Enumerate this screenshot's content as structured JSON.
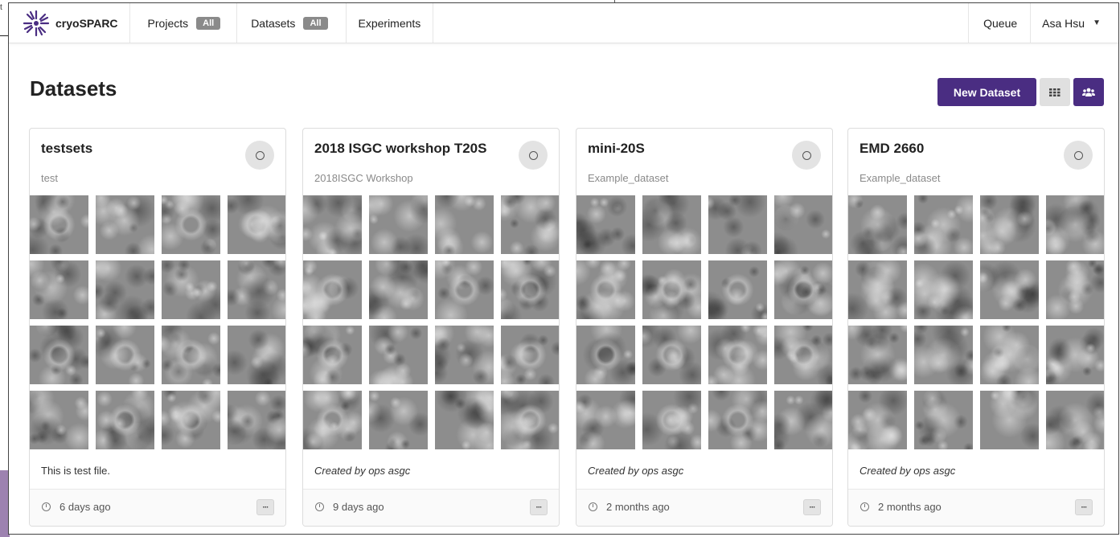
{
  "navbar": {
    "brand": "cryoSPARC",
    "projects_label": "Projects",
    "projects_badge": "All",
    "datasets_label": "Datasets",
    "datasets_badge": "All",
    "experiments_label": "Experiments",
    "queue_label": "Queue",
    "user_name": "Asa Hsu"
  },
  "page": {
    "title": "Datasets",
    "new_dataset_label": "New Dataset",
    "view_grid_icon": "grid-icon",
    "view_group_icon": "users-icon"
  },
  "colors": {
    "accent": "#4a2d82",
    "badge": "#8a8a8a"
  },
  "cards": [
    {
      "title": "testsets",
      "subtitle": "test",
      "description": "This is test file.",
      "time": "6 days ago"
    },
    {
      "title": "2018 ISGC workshop T20S",
      "subtitle": "2018ISGC Workshop",
      "description": "Created by ops asgc",
      "time": "9 days ago"
    },
    {
      "title": "mini-20S",
      "subtitle": "Example_dataset",
      "description": "Created by ops asgc",
      "time": "2 months ago"
    },
    {
      "title": "EMD 2660",
      "subtitle": "Example_dataset",
      "description": "Created by ops asgc",
      "time": "2 months ago"
    }
  ],
  "more_label": "···",
  "underlying_window_letter": "t"
}
